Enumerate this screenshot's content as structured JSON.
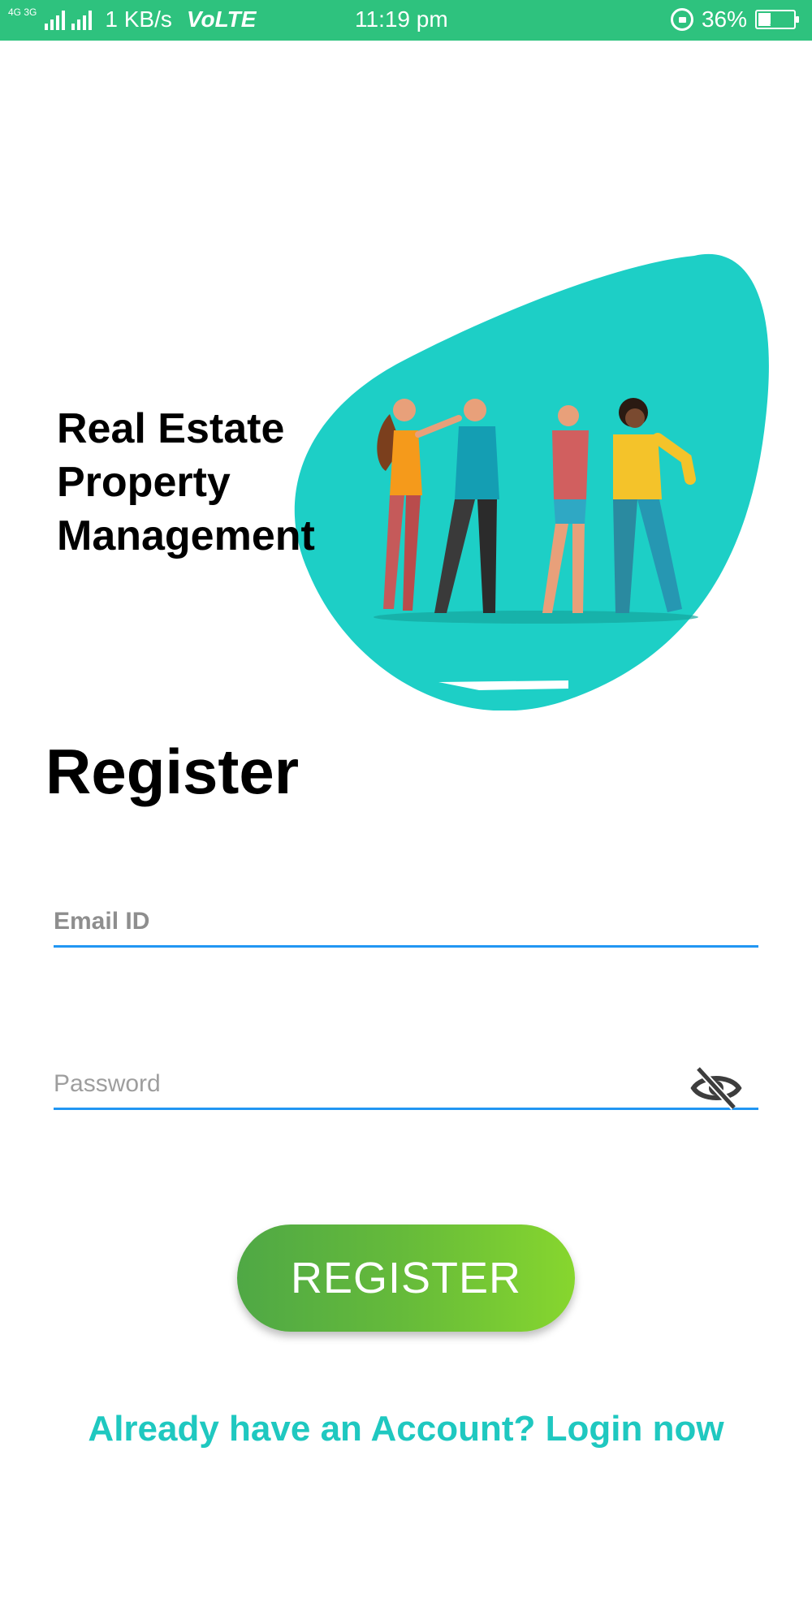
{
  "status_bar": {
    "network_small": "4G 3G",
    "speed": "1 KB/s",
    "volte": "VoLTE",
    "time": "11:19 pm",
    "battery": "36%",
    "battery_level": 0.36
  },
  "hero": {
    "title": "Real Estate\nProperty\nManagement"
  },
  "form": {
    "heading": "Register",
    "email_placeholder": "Email ID",
    "password_placeholder": "Password",
    "submit_label": "REGISTER",
    "login_link": "Already have an Account? Login now"
  },
  "colors": {
    "status_bar": "#2ec27e",
    "blob": "#1dcfc6",
    "accent_underline": "#2196f3",
    "link": "#1fc8c0",
    "button_start": "#4fa845",
    "button_end": "#87d62e"
  }
}
